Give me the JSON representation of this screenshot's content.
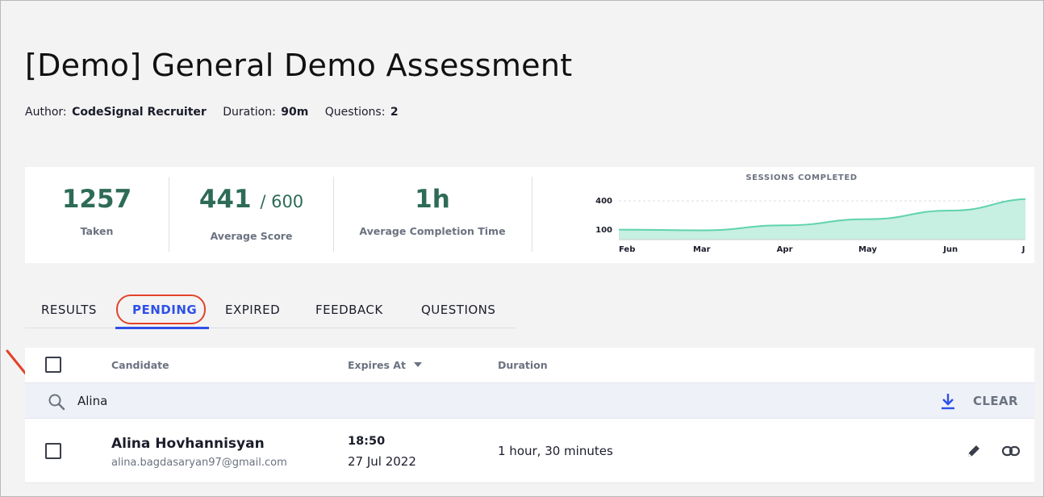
{
  "page": {
    "title": "[Demo] General Demo Assessment",
    "meta": {
      "author_label": "Author:",
      "author_value": "CodeSignal Recruiter",
      "duration_label": "Duration:",
      "duration_value": "90m",
      "questions_label": "Questions:",
      "questions_value": "2"
    }
  },
  "stats": {
    "taken_value": "1257",
    "taken_label": "Taken",
    "avg_score_value": "441",
    "avg_score_max": "/ 600",
    "avg_score_label": "Average Score",
    "avg_time_value": "1h",
    "avg_time_label": "Average Completion Time"
  },
  "chart_data": {
    "type": "area",
    "title": "SESSIONS COMPLETED",
    "categories": [
      "Feb",
      "Mar",
      "Apr",
      "May",
      "Jun",
      "Jul"
    ],
    "series": [
      {
        "values": [
          103,
          96,
          148,
          211,
          300,
          420
        ]
      }
    ],
    "y_ticks": [
      "400",
      "100"
    ],
    "ylim": [
      0,
      450
    ],
    "grid": true,
    "color": "#5fd3ae",
    "fill": "#c7efe2"
  },
  "tabs": [
    {
      "label": "RESULTS",
      "active": false
    },
    {
      "label": "PENDING",
      "active": true
    },
    {
      "label": "EXPIRED",
      "active": false
    },
    {
      "label": "FEEDBACK",
      "active": false
    },
    {
      "label": "QUESTIONS",
      "active": false
    }
  ],
  "table": {
    "columns": {
      "candidate": "Candidate",
      "expires_at": "Expires At",
      "duration": "Duration"
    },
    "search_value": "Alina",
    "clear_label": "CLEAR",
    "rows": [
      {
        "name": "Alina Hovhannisyan",
        "email": "alina.bagdasaryan97@gmail.com",
        "expires_time": "18:50",
        "expires_date": "27 Jul 2022",
        "duration": "1 hour, 30 minutes"
      }
    ]
  },
  "colors": {
    "accent": "#2e50e8",
    "stat_green": "#2e6b57",
    "annotation": "#e2432a"
  },
  "icons": {
    "search": "search-icon",
    "sort": "caret-down-icon",
    "download": "download-icon",
    "edit": "pencil-icon",
    "link": "link-icon",
    "annotation": "arrow-icon"
  }
}
